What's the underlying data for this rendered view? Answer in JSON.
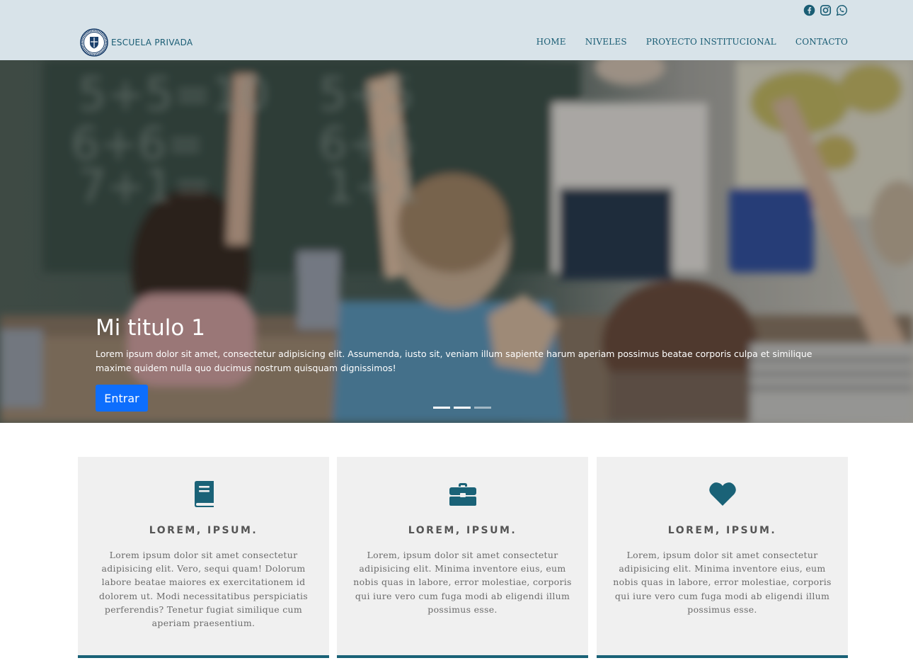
{
  "header": {
    "brand": "ESCUELA PRIVADA",
    "social": [
      "facebook-icon",
      "instagram-icon",
      "whatsapp-icon"
    ],
    "nav": [
      "HOME",
      "NIVELES",
      "PROYECTO INSTITUCIONAL",
      "CONTACTO"
    ]
  },
  "hero": {
    "title": "Mi titulo 1",
    "text": "Lorem ipsum dolor sit amet, consectetur adipisicing elit. Assumenda, iusto sit, veniam illum sapiente harum aperiam possimus beatae corporis culpa et similique maxime quidem nulla quo ducimus nostrum quisquam dignissimos!",
    "button": "Entrar",
    "slides_count": 3,
    "active_slide": 1
  },
  "cards": [
    {
      "icon": "book-icon",
      "title": "LOREM, IPSUM.",
      "text": "Lorem ipsum dolor sit amet consectetur adipisicing elit. Vero, sequi quam! Dolorum labore beatae maiores ex exercitationem id dolorem ut. Modi necessitatibus perspiciatis perferendis? Tenetur fugiat similique cum aperiam praesentium."
    },
    {
      "icon": "briefcase-icon",
      "title": "LOREM, IPSUM.",
      "text": "Lorem, ipsum dolor sit amet consectetur adipisicing elit. Minima inventore eius, eum nobis quas in labore, error molestiae, corporis qui iure vero cum fuga modi ab eligendi illum possimus esse."
    },
    {
      "icon": "heart-icon",
      "title": "LOREM, IPSUM.",
      "text": "Lorem, ipsum dolor sit amet consectetur adipisicing elit. Minima inventore eius, eum nobis quas in labore, error molestiae, corporis qui iure vero cum fuga modi ab eligendi illum possimus esse."
    }
  ],
  "colors": {
    "header_bg": "#d8e3e9",
    "accent": "#1a6277",
    "button": "#0d6efd"
  }
}
